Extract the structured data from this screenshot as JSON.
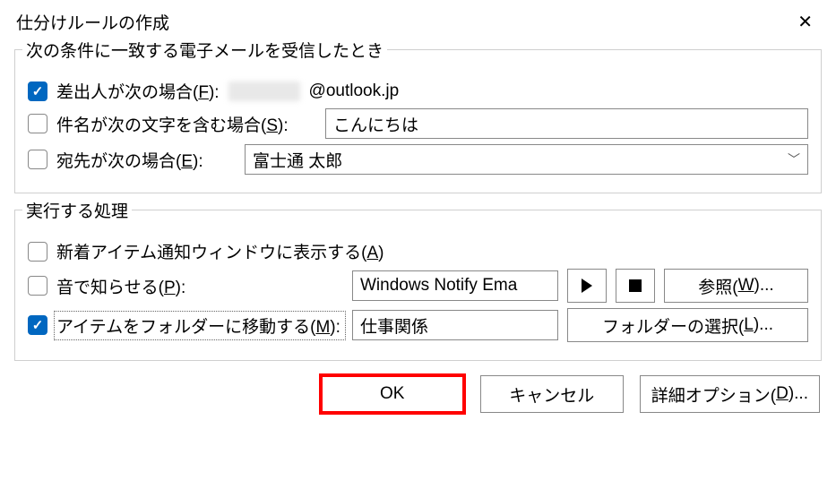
{
  "title": "仕分けルールの作成",
  "group1": {
    "legend": "次の条件に一致する電子メールを受信したとき",
    "sender": {
      "label_prefix": "差出人が次の場合(",
      "label_key": "F",
      "label_suffix": "):",
      "value_suffix": "@outlook.jp",
      "checked": true
    },
    "subject": {
      "label_prefix": "件名が次の文字を含む場合(",
      "label_key": "S",
      "label_suffix": "):",
      "value": "こんにちは",
      "checked": false
    },
    "recipient": {
      "label_prefix": "宛先が次の場合(",
      "label_key": "E",
      "label_suffix": "):",
      "value": "富士通 太郎",
      "checked": false
    }
  },
  "group2": {
    "legend": "実行する処理",
    "alert": {
      "label_prefix": "新着アイテム通知ウィンドウに表示する(",
      "label_key": "A",
      "label_suffix": ")",
      "checked": false
    },
    "sound": {
      "label_prefix": "音で知らせる(",
      "label_key": "P",
      "label_suffix": "):",
      "value": "Windows Notify Ema",
      "browse_prefix": "参照(",
      "browse_key": "W",
      "browse_suffix": ")...",
      "checked": false
    },
    "move": {
      "label_prefix": "アイテムをフォルダーに移動する(",
      "label_key": "M",
      "label_suffix": "):",
      "value": "仕事関係",
      "folder_prefix": "フォルダーの選択(",
      "folder_key": "L",
      "folder_suffix": ")...",
      "checked": true
    }
  },
  "buttons": {
    "ok": "OK",
    "cancel": "キャンセル",
    "advanced_prefix": "詳細オプション(",
    "advanced_key": "D",
    "advanced_suffix": ")..."
  }
}
